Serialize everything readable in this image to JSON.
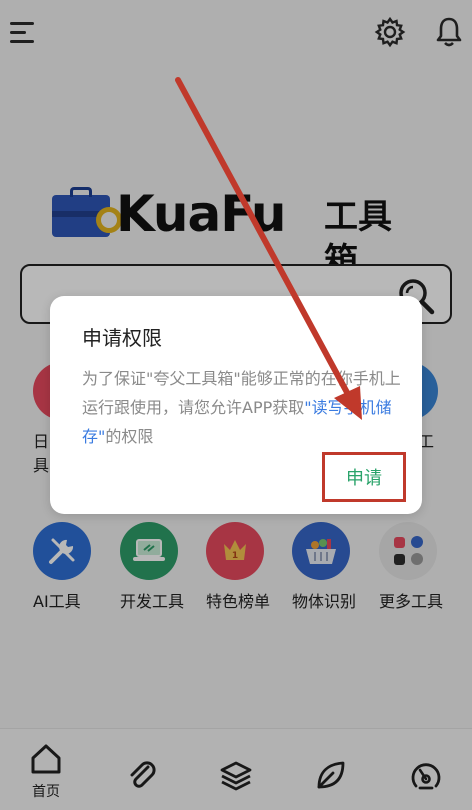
{
  "app": {
    "logo_text": "KuaFu",
    "logo_cn": "工具箱"
  },
  "search": {
    "placeholder": ""
  },
  "partial_row": {
    "left_fragment": "日具",
    "right_fragment": "工"
  },
  "tools": [
    {
      "label": "AI工具",
      "icon": "wrench-icon",
      "color": "#2f6fd6"
    },
    {
      "label": "开发工具",
      "icon": "laptop-icon",
      "color": "#2f9e6a"
    },
    {
      "label": "特色榜单",
      "icon": "medal-icon",
      "color": "#e84a5f"
    },
    {
      "label": "物体识别",
      "icon": "basket-icon",
      "color": "#3767c9"
    },
    {
      "label": "更多工具",
      "icon": "apps-icon",
      "color": "#e6e6e6"
    }
  ],
  "dialog": {
    "title": "申请权限",
    "body_pre": "为了保证\"夸父工具箱\"能够正常的在你手机上运行跟使用，请您允许APP获取",
    "body_link": "\"读写手机储存\"",
    "body_post": "的权限",
    "button_label": "申请"
  },
  "bottom_nav": [
    {
      "label": "首页",
      "icon": "home-icon"
    },
    {
      "label": "",
      "icon": "paperclip-icon"
    },
    {
      "label": "",
      "icon": "layers-icon"
    },
    {
      "label": "",
      "icon": "leaf-icon"
    },
    {
      "label": "",
      "icon": "dashboard-icon"
    }
  ],
  "colors": {
    "accent_green": "#29a36a",
    "link_blue": "#3a7be0",
    "annotation_red": "#c0392b"
  }
}
